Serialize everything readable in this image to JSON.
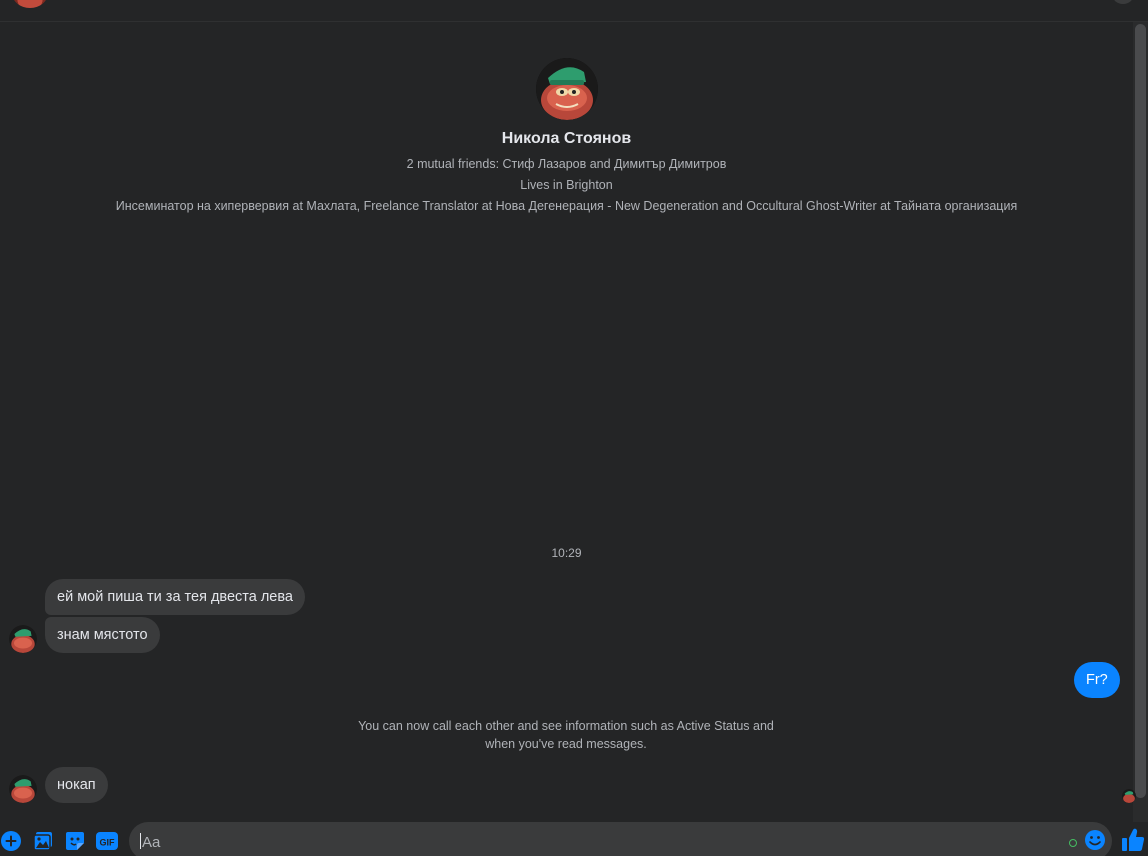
{
  "profile": {
    "name": "Никола Стоянов",
    "mutual_friends": "2 mutual friends: Стиф Лазаров and Димитър Димитров",
    "lives_in": "Lives in Brighton",
    "work": "Инсеминатор на хипервервия at Махлата, Freelance Translator at Нова Дегенерация - New Degeneration and Occultural Ghost-Writer at Тайната организация"
  },
  "conversation": {
    "timestamp": "10:29",
    "messages": [
      {
        "sender": "them",
        "text": "ей мой пиша ти за тея двеста лева"
      },
      {
        "sender": "them",
        "text": "знам мястото"
      },
      {
        "sender": "me",
        "text": "Fr?"
      },
      {
        "sender": "them",
        "text": "нокап"
      }
    ],
    "system_notice": {
      "line1": "You can now call each other and see information such as Active Status and",
      "line2": "when you've read messages."
    }
  },
  "composer": {
    "placeholder": "Aa",
    "tools": [
      "add-icon",
      "image-icon",
      "sticker-icon",
      "gif-icon"
    ],
    "gif_label": "GIF"
  },
  "colors": {
    "background": "#242526",
    "bubble_incoming": "#3a3b3c",
    "bubble_outgoing": "#0a84ff",
    "accent": "#0a84ff",
    "text_secondary": "#b0b3b8"
  }
}
